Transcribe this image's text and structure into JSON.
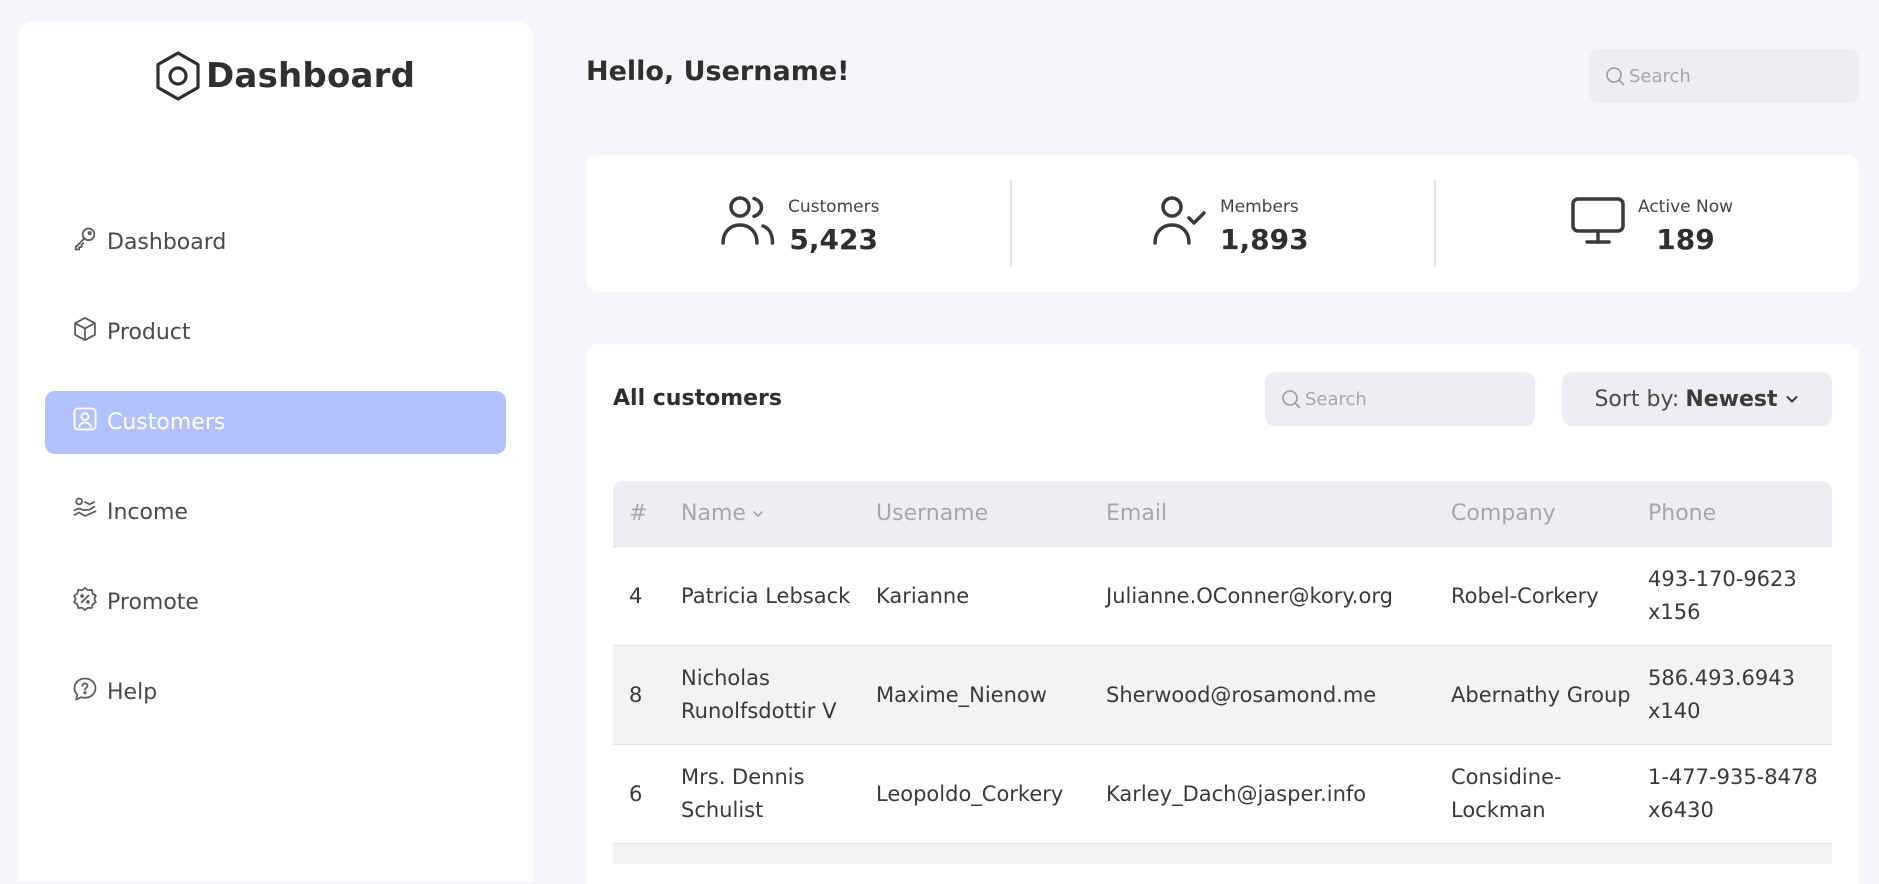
{
  "app": {
    "title": "Dashboard"
  },
  "sidebar": {
    "items": [
      {
        "label": "Dashboard",
        "icon": "key-icon"
      },
      {
        "label": "Product",
        "icon": "cube-icon"
      },
      {
        "label": "Customers",
        "icon": "user-square-icon",
        "active": true
      },
      {
        "label": "Income",
        "icon": "wallet-money-icon"
      },
      {
        "label": "Promote",
        "icon": "discount-badge-icon"
      },
      {
        "label": "Help",
        "icon": "message-question-icon"
      }
    ]
  },
  "header": {
    "greeting": "Hello, Username!",
    "search_placeholder": "Search"
  },
  "stats": [
    {
      "label": "Customers",
      "value": "5,423",
      "icon": "users-icon"
    },
    {
      "label": "Members",
      "value": "1,893",
      "icon": "user-check-icon"
    },
    {
      "label": "Active Now",
      "value": "189",
      "icon": "monitor-icon"
    }
  ],
  "customers": {
    "title": "All customers",
    "search_placeholder": "Search",
    "sort_label": "Sort by:",
    "sort_value": "Newest",
    "columns": [
      "#",
      "Name",
      "Username",
      "Email",
      "Company",
      "Phone"
    ],
    "rows": [
      {
        "id": "4",
        "name": "Patricia Lebsack",
        "username": "Karianne",
        "email": "Julianne.OConner@kory.org",
        "company": "Robel-Corkery",
        "phone": "493-170-9623 x156"
      },
      {
        "id": "8",
        "name": "Nicholas Runolfsdottir V",
        "username": "Maxime_Nienow",
        "email": "Sherwood@rosamond.me",
        "company": "Abernathy Group",
        "phone": "586.493.6943 x140"
      },
      {
        "id": "6",
        "name": "Mrs. Dennis Schulist",
        "username": "Leopoldo_Corkery",
        "email": "Karley_Dach@jasper.info",
        "company": "Considine-Lockman",
        "phone": "1-477-935-8478 x6430"
      }
    ]
  },
  "colors": {
    "accent": "#b2c2ff",
    "background": "#f5f6fa",
    "card": "#ffffff",
    "input": "#eeeef2",
    "text": "#2f2f2f",
    "muted": "#a6a6ab"
  }
}
